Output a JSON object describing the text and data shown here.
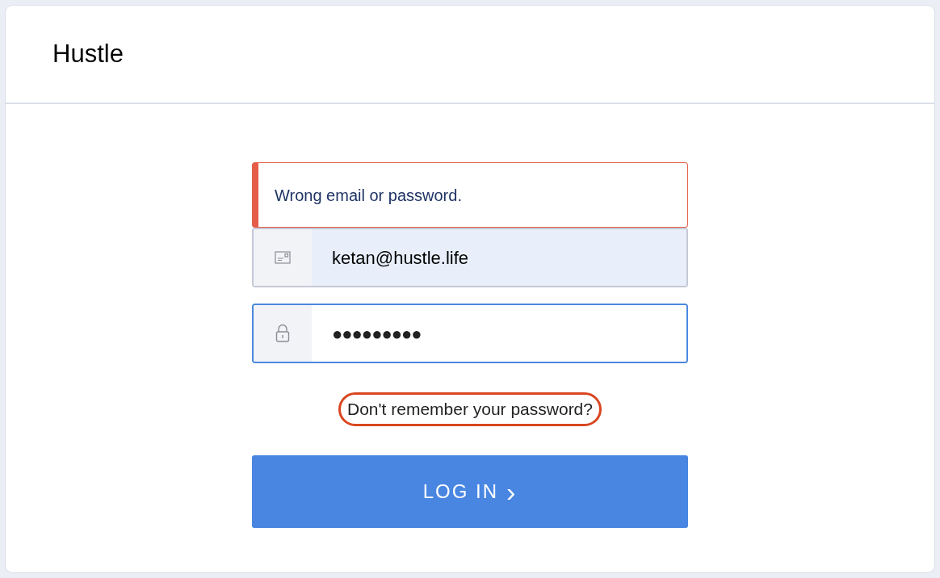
{
  "header": {
    "title": "Hustle"
  },
  "error": {
    "message": "Wrong email or password."
  },
  "fields": [
    {
      "kind": "email",
      "value": "ketan@hustle.life",
      "autofilled": true,
      "focused": false
    },
    {
      "kind": "password",
      "value": "●●●●●●●●●",
      "autofilled": false,
      "focused": true
    }
  ],
  "forgot_link": {
    "label": "Don't remember your password?",
    "highlighted": true
  },
  "login_button": {
    "label": "LOG IN",
    "icon": "›"
  }
}
